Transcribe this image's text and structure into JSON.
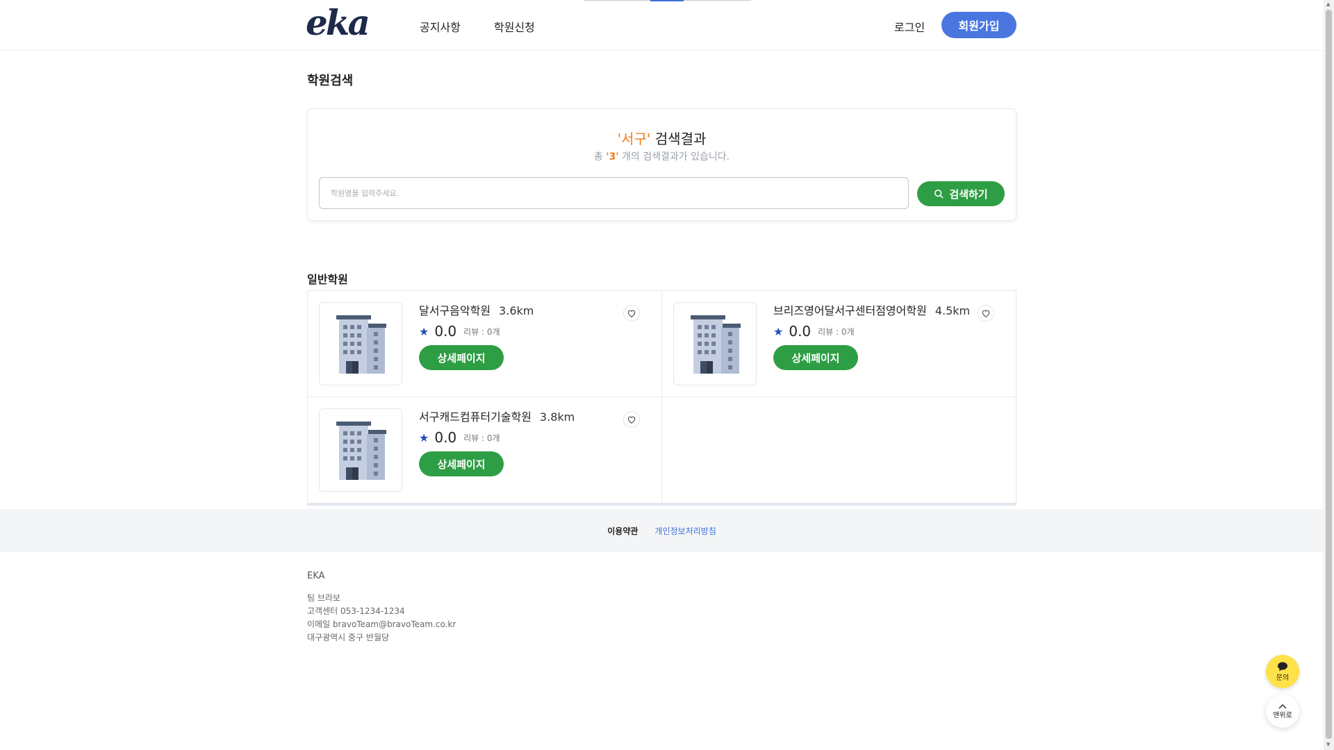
{
  "header": {
    "logo": "eka",
    "nav": [
      "공지사항",
      "학원신청"
    ],
    "login": "로그인",
    "signup": "회원가입"
  },
  "page_title": "학원검색",
  "search": {
    "keyword_display": "'서구'",
    "title_suffix": " 검색결과",
    "sub_prefix": "총 ",
    "count_display": "'3'",
    "sub_suffix": " 개의 검색결과가 있습니다.",
    "placeholder": "학원명을 입력주세요.",
    "button": "검색하기"
  },
  "section_title": "일반학원",
  "academies": [
    {
      "name": "달서구음악학원",
      "distance": "3.6km",
      "score": "0.0",
      "reviews": "리뷰 : 0개",
      "button": "상세페이지"
    },
    {
      "name": "브리즈영어달서구센터점영어학원",
      "distance": "4.5km",
      "score": "0.0",
      "reviews": "리뷰 : 0개",
      "button": "상세페이지"
    },
    {
      "name": "서구캐드컴퓨터기술학원",
      "distance": "3.8km",
      "score": "0.0",
      "reviews": "리뷰 : 0개",
      "button": "상세페이지"
    }
  ],
  "footer": {
    "terms": "이용약관",
    "privacy": "개인정보처리방침",
    "brand": "EKA",
    "team": "팀 브라보",
    "phone": "고객센터 053-1234-1234",
    "email": "이메일 bravoTeam@bravoTeam.co.kr",
    "address": "대구광역시 중구 반월당"
  },
  "floating": {
    "inquiry": "문의",
    "top": "맨위로"
  },
  "colors": {
    "primary_blue": "#4a76e0",
    "green": "#2e9e44",
    "orange": "#f07c1c",
    "star_blue": "#1f4fb8",
    "kakao_yellow": "#ffe14a"
  }
}
